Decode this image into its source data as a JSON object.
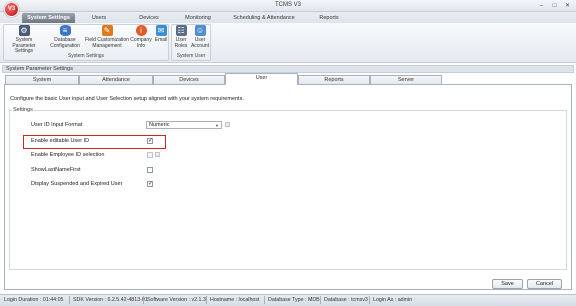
{
  "window": {
    "title": "TCMS V3",
    "logo_text": "V3"
  },
  "menu": {
    "active": "System Settings",
    "tabs": [
      "Users",
      "Devices",
      "Monitoring",
      "Scheduling & Attendance",
      "Reports"
    ]
  },
  "ribbon": {
    "buttons": [
      {
        "label1": "System Parameter",
        "label2": "Settings",
        "icon": "gears-icon",
        "color": "#4a5a78"
      },
      {
        "label1": "Database",
        "label2": "Configuration",
        "icon": "database-icon",
        "color": "#3e78c4"
      },
      {
        "label1": "Field Customization",
        "label2": "Management",
        "icon": "pencil-icon",
        "color": "#e07a1f"
      },
      {
        "label1": "Company",
        "label2": "Info",
        "icon": "info-icon",
        "color": "#e05a2a"
      },
      {
        "label1": "Email",
        "label2": "",
        "icon": "email-icon",
        "color": "#3b8fd1"
      },
      {
        "label1": "User",
        "label2": "Roles",
        "icon": "user-roles-icon",
        "color": "#5b6e85"
      },
      {
        "label1": "User",
        "label2": "Account",
        "icon": "user-account-icon",
        "color": "#4f8fcf"
      }
    ],
    "group_system_settings": "System Settings",
    "group_system_user": "System User"
  },
  "panel": {
    "header": "System Parameter Settings",
    "tabs": [
      "System",
      "Attendance",
      "Devices",
      "User",
      "Reports",
      "Server"
    ],
    "active_tab": "User",
    "description": "Configure the basic User input and User Selection setup aligned with your system requirements.",
    "group_label": "Settings",
    "rows": {
      "id_format_label": "User ID Input Format",
      "id_format_value": "Numeric",
      "editable_label": "Enable editable User ID",
      "editable_checked": true,
      "emp_id_label": "Enable Employee ID selection",
      "emp_id_checked": false,
      "last_name_label": "ShowLastNameFirst",
      "last_name_checked": false,
      "suspended_label": "Display Suspended and Expired User",
      "suspended_checked": true
    },
    "save_label": "Save",
    "cancel_label": "Cancel"
  },
  "status": {
    "login_duration": "Login Duration : 01:44:05",
    "sdk": "SDK Version : 6.2.5.42-4813-01",
    "software": "Software Version : v2.1.3",
    "hostname": "Hostname : localhost",
    "db_type": "Database Type : MDB",
    "db": "Database : tcmsv3",
    "login_as": "Login As : admin"
  }
}
